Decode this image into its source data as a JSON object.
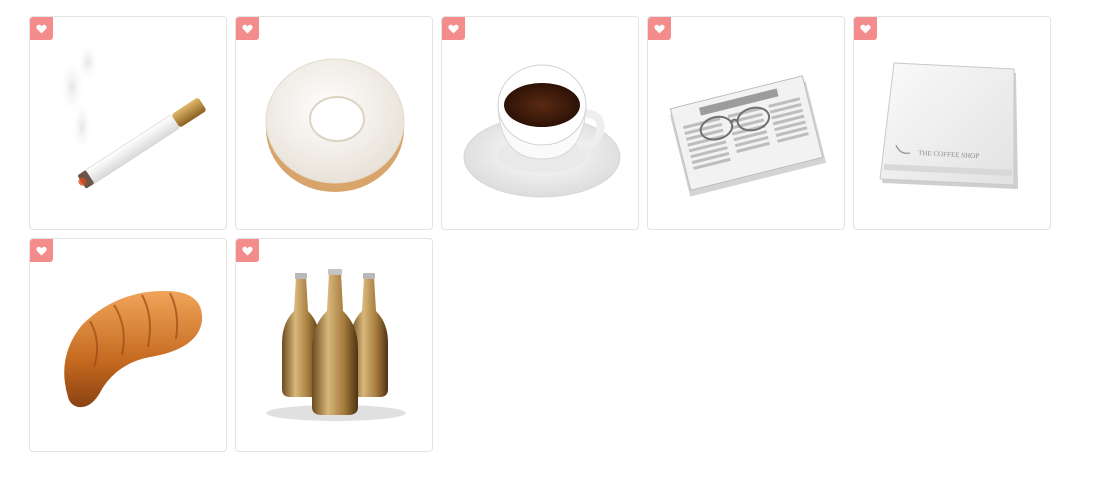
{
  "colors": {
    "favorite_badge": "#f48c8c",
    "card_border": "#e3e3e3",
    "background": "#ffffff"
  },
  "icons": [
    {
      "name": "cigarette-icon",
      "favorite_icon": "heart-icon"
    },
    {
      "name": "donut-icon",
      "favorite_icon": "heart-icon"
    },
    {
      "name": "coffee-cup-icon",
      "favorite_icon": "heart-icon"
    },
    {
      "name": "newspaper-glasses-icon",
      "favorite_icon": "heart-icon"
    },
    {
      "name": "napkin-icon",
      "favorite_icon": "heart-icon",
      "text": "THE COFFEE SHOP"
    },
    {
      "name": "croissant-icon",
      "favorite_icon": "heart-icon"
    },
    {
      "name": "beer-bottles-icon",
      "favorite_icon": "heart-icon"
    }
  ]
}
